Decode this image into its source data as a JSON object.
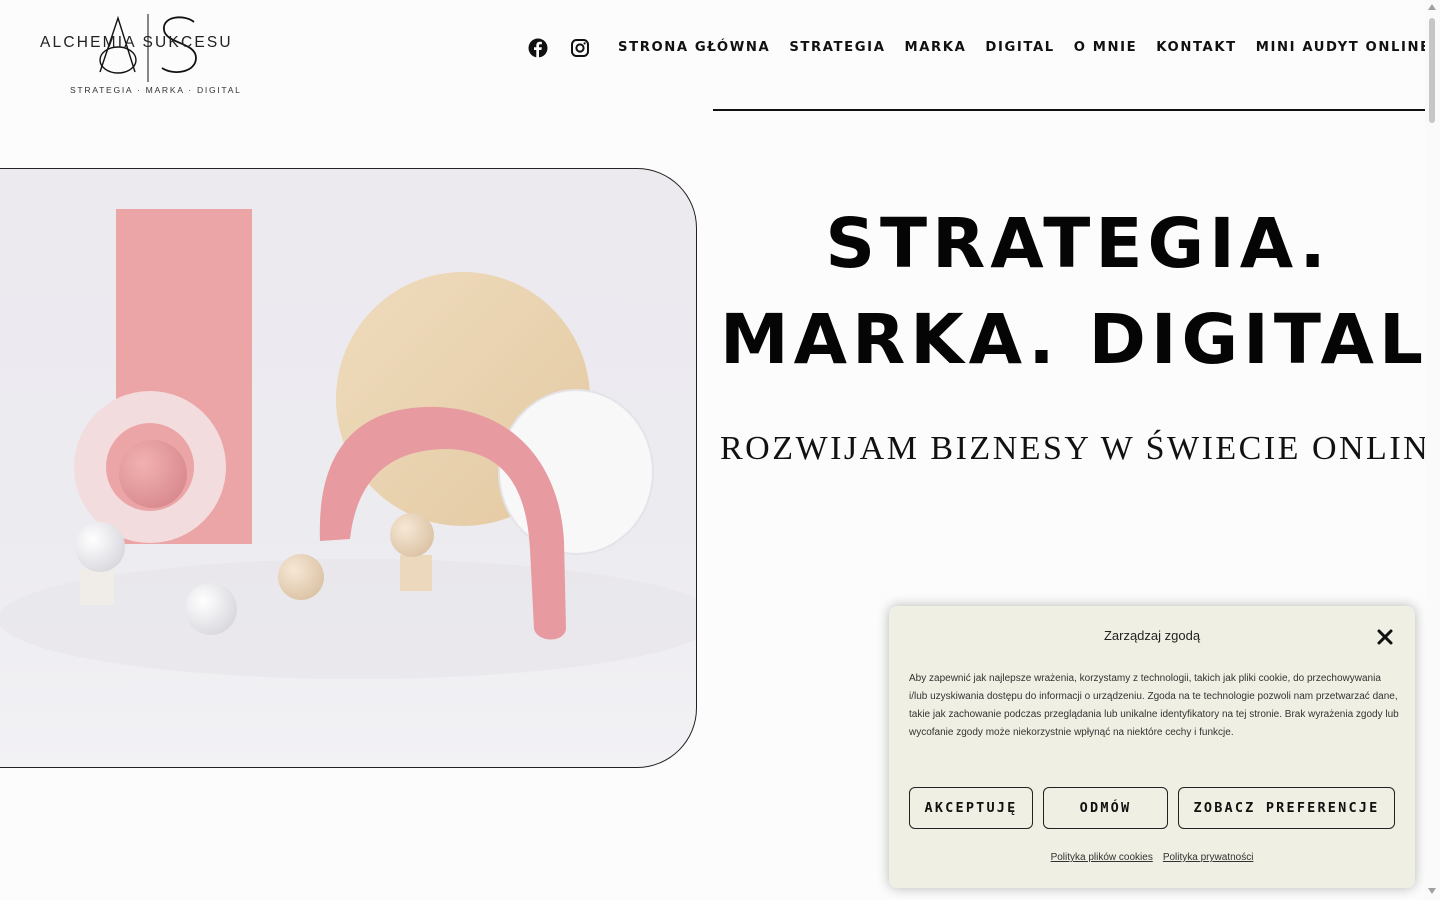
{
  "logo": {
    "brand_name": "ALCHEMIA SUKCESU",
    "tagline": "STRATEGIA · MARKA · DIGITAL",
    "monogram": "AS"
  },
  "nav": {
    "social": [
      {
        "icon": "facebook-icon"
      },
      {
        "icon": "instagram-icon"
      }
    ],
    "items": [
      {
        "label": "STRONA GŁÓWNA"
      },
      {
        "label": "STRATEGIA"
      },
      {
        "label": "MARKA"
      },
      {
        "label": "DIGITAL"
      },
      {
        "label": "O MNIE"
      },
      {
        "label": "KONTAKT"
      },
      {
        "label": "MINI AUDYT ONLINE"
      }
    ]
  },
  "hero": {
    "headline_line1": "STRATEGIA.",
    "headline_line2": "MARKA. DIGITAL.",
    "subheadline": "ROZWIJAM BIZNESY W ŚWIECIE ONLINE"
  },
  "consent": {
    "title": "Zarządzaj zgodą",
    "body": "Aby zapewnić jak najlepsze wrażenia, korzystamy z technologii, takich jak pliki cookie, do przechowywania i/lub uzyskiwania dostępu do informacji o urządzeniu. Zgoda na te technologie pozwoli nam przetwarzać dane, takie jak zachowanie podczas przeglądania lub unikalne identyfikatory na tej stronie. Brak wyrażenia zgody lub wycofanie zgody może niekorzystnie wpłynąć na niektóre cechy i funkcje.",
    "accept_label": "AKCEPTUJĘ",
    "deny_label": "ODMÓW",
    "preferences_label": "ZOBACZ PREFERENCJE",
    "cookie_policy_link": "Polityka plików cookies",
    "privacy_policy_link": "Polityka prywatności"
  },
  "colors": {
    "page_bg": "#fbfcfb",
    "text": "#0b0b0b",
    "modal_bg": "#efefe3",
    "accent_pink": "#e9a3a6"
  }
}
